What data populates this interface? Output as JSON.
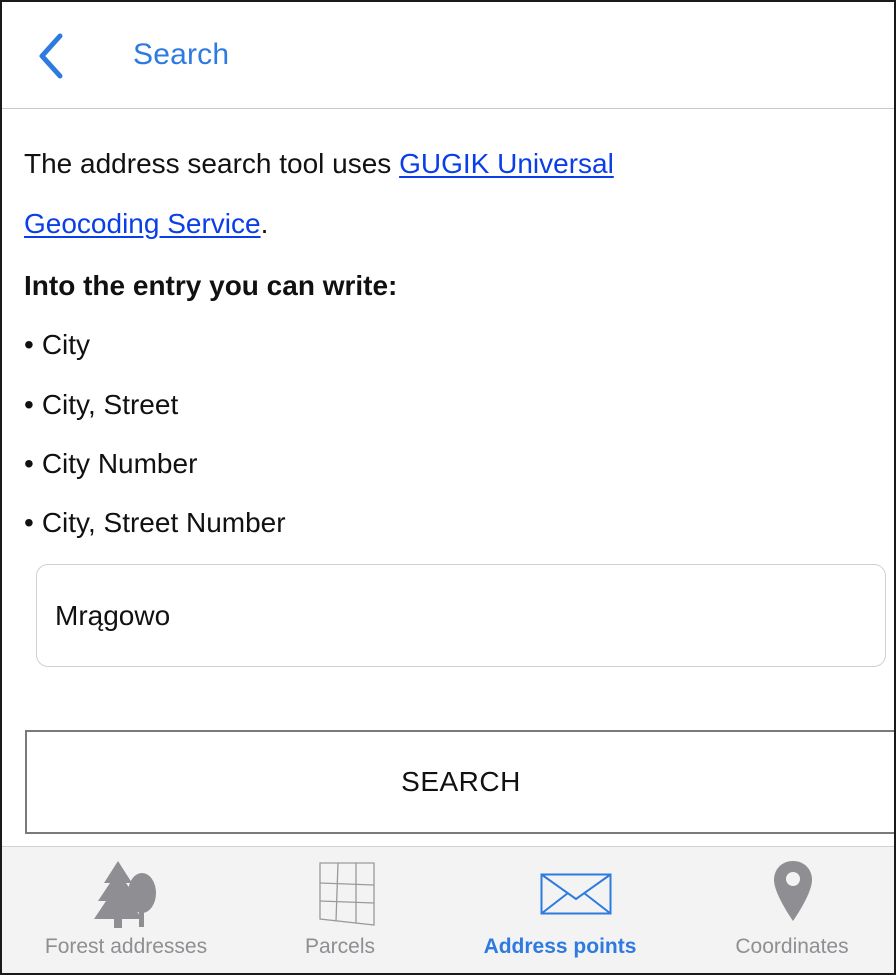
{
  "header": {
    "title": "Search",
    "back_icon": "chevron-left-icon"
  },
  "content": {
    "intro_text": "The address search tool uses ",
    "link_part1": "GUGIK Universal",
    "link_part2": "Geocoding Service",
    "intro_end": ".",
    "heading": "Into the entry you can write:",
    "bullet": "•",
    "formats": [
      "City",
      "City, Street",
      "City Number",
      "City, Street Number"
    ]
  },
  "entry": {
    "value": "Mrągowo",
    "placeholder": ""
  },
  "search_button": {
    "label": "SEARCH"
  },
  "tabbar": {
    "tabs": [
      {
        "label": "Forest addresses",
        "icon": "forest-icon",
        "active": false
      },
      {
        "label": "Parcels",
        "icon": "parcels-grid-icon",
        "active": false
      },
      {
        "label": "Address points",
        "icon": "envelope-icon",
        "active": true
      },
      {
        "label": "Coordinates",
        "icon": "map-pin-icon",
        "active": false
      }
    ]
  },
  "colors": {
    "accent": "#2d7ae0",
    "link": "#0a3ee8",
    "inactive_tab": "#8e8e93",
    "tabbar_bg": "#f3f3f3"
  }
}
